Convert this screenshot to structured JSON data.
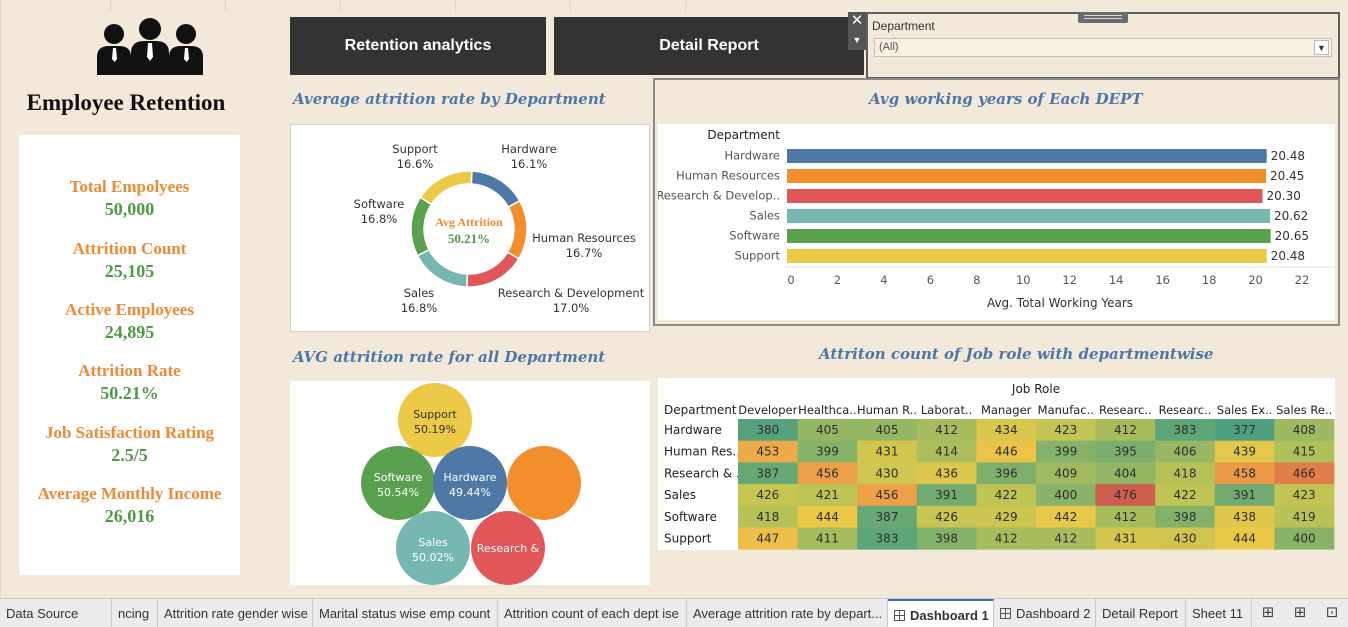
{
  "header": {
    "title": "Employee Retention",
    "buttons": {
      "retention": "Retention analytics",
      "detail": "Detail Report"
    }
  },
  "kpis": [
    {
      "label": "Total Empolyees",
      "value": "50,000"
    },
    {
      "label": "Attrition Count",
      "value": "25,105"
    },
    {
      "label": "Active Employees",
      "value": "24,895"
    },
    {
      "label": "Attrition Rate",
      "value": "50.21%"
    },
    {
      "label": "Job Satisfaction Rating",
      "value": "2.5/5"
    },
    {
      "label": "Average Monthly Income",
      "value": "26,016"
    }
  ],
  "filter": {
    "label": "Department",
    "value": "(All)"
  },
  "sections": {
    "donut": "Average attrition rate by Department",
    "bar": "Avg working years of Each DEPT",
    "bubble": "AVG attrition rate for all Department",
    "heatmap": "Attriton count of Job role with departmentwise"
  },
  "colors": {
    "Hardware": "#4e79a7",
    "Human Resources": "#f28e2b",
    "Research & Development": "#e15759",
    "Sales": "#76b7b2",
    "Software": "#59a14f",
    "Support": "#edc948"
  },
  "chart_data": [
    {
      "type": "pie",
      "center_label": "Avg Attrition",
      "center_value": "50.21%",
      "slices": [
        {
          "label": "Hardware",
          "pct": "16.1%",
          "value": 16.1
        },
        {
          "label": "Human Resources",
          "pct": "16.7%",
          "value": 16.7
        },
        {
          "label": "Research & Development",
          "pct": "17.0%",
          "value": 17.0
        },
        {
          "label": "Sales",
          "pct": "16.8%",
          "value": 16.8
        },
        {
          "label": "Software",
          "pct": "16.8%",
          "value": 16.8
        },
        {
          "label": "Support",
          "pct": "16.6%",
          "value": 16.6
        }
      ]
    },
    {
      "type": "bar",
      "ylabel": "Department",
      "xlabel": "Avg. Total Working Years",
      "xlim": [
        0,
        22
      ],
      "ticks": [
        "0",
        "2",
        "4",
        "6",
        "8",
        "10",
        "12",
        "14",
        "16",
        "18",
        "20",
        "22"
      ],
      "categories": [
        "Hardware",
        "Human Resources",
        "Research & Develop..",
        "Sales",
        "Software",
        "Support"
      ],
      "color_keys": [
        "Hardware",
        "Human Resources",
        "Research & Development",
        "Sales",
        "Software",
        "Support"
      ],
      "values": [
        20.48,
        20.45,
        20.3,
        20.62,
        20.65,
        20.48
      ],
      "labels": [
        "20.48",
        "20.45",
        "20.30",
        "20.62",
        "20.65",
        "20.48"
      ]
    },
    {
      "type": "scatter",
      "bubbles": [
        {
          "name": "Support",
          "label": "50.19%",
          "value": 50.19,
          "color_key": "Support"
        },
        {
          "name": "Software",
          "label": "50.54%",
          "value": 50.54,
          "color_key": "Software"
        },
        {
          "name": "Hardware",
          "label": "49.44%",
          "value": 49.44,
          "color_key": "Hardware"
        },
        {
          "name": "",
          "label": "",
          "color_key": "Human Resources"
        },
        {
          "name": "Sales",
          "label": "50.02%",
          "value": 50.02,
          "color_key": "Sales"
        },
        {
          "name": "Research &",
          "label": "",
          "color_key": "Research & Development"
        }
      ]
    },
    {
      "type": "heatmap",
      "column_header": "Job Role",
      "row_header": "Department",
      "columns": [
        "Developer",
        "Healthca..",
        "Human R..",
        "Laborat..",
        "Manager",
        "Manufac..",
        "Researc..",
        "Researc..",
        "Sales Ex..",
        "Sales Re.."
      ],
      "rows": [
        "Hardware",
        "Human Res..",
        "Research & ..",
        "Sales",
        "Software",
        "Support"
      ],
      "values": [
        [
          380,
          405,
          405,
          412,
          434,
          423,
          412,
          383,
          377,
          408
        ],
        [
          453,
          399,
          431,
          414,
          446,
          399,
          395,
          406,
          439,
          415
        ],
        [
          387,
          456,
          430,
          436,
          396,
          409,
          404,
          418,
          458,
          466
        ],
        [
          426,
          421,
          456,
          391,
          422,
          400,
          476,
          422,
          391,
          423
        ],
        [
          418,
          444,
          387,
          426,
          429,
          442,
          412,
          398,
          438,
          419
        ],
        [
          447,
          411,
          383,
          398,
          412,
          412,
          431,
          430,
          444,
          400
        ]
      ]
    }
  ],
  "tabs": [
    {
      "label": "Data Source",
      "active": false
    },
    {
      "label": "ncing",
      "active": false
    },
    {
      "label": "Attrition rate gender wise",
      "active": false
    },
    {
      "label": "Marital status wise emp count",
      "active": false
    },
    {
      "label": "Attrition count of each dept ise",
      "active": false
    },
    {
      "label": "Average attrition rate by depart...",
      "active": false
    },
    {
      "label": "Dashboard 1",
      "active": true
    },
    {
      "label": "Dashboard 2",
      "active": false
    },
    {
      "label": "Detail Report",
      "active": false
    },
    {
      "label": "Sheet 11",
      "active": false
    }
  ]
}
